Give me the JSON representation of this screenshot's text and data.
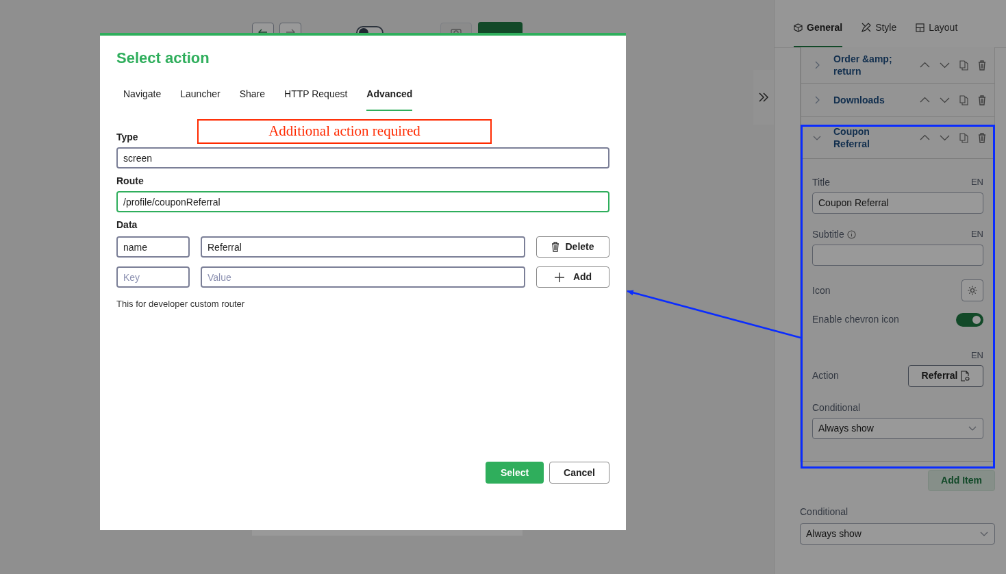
{
  "toolbar": {
    "mode_toggle": {
      "on": false
    }
  },
  "modal": {
    "title": "Select action",
    "tabs": [
      {
        "label": "Navigate",
        "selected": false
      },
      {
        "label": "Launcher",
        "selected": false
      },
      {
        "label": "Share",
        "selected": false
      },
      {
        "label": "HTTP Request",
        "selected": false
      },
      {
        "label": "Advanced",
        "selected": true
      }
    ],
    "annotation": "Additional action required",
    "type": {
      "label": "Type",
      "value": "screen"
    },
    "route": {
      "label": "Route",
      "value": "/profile/couponReferral"
    },
    "data": {
      "label": "Data",
      "rows": [
        {
          "kind": "entry",
          "key": "name",
          "value": "Referral",
          "button": "Delete"
        },
        {
          "kind": "new",
          "key_placeholder": "Key",
          "value_placeholder": "Value",
          "button": "Add"
        }
      ]
    },
    "help": "This for developer custom router",
    "buttons": [
      "Select",
      "Cancel"
    ]
  },
  "panel": {
    "tabs": [
      {
        "label": "General",
        "selected": true
      },
      {
        "label": "Style",
        "selected": false
      },
      {
        "label": "Layout",
        "selected": false
      }
    ],
    "items": [
      {
        "title": "Order &amp; return",
        "expanded": false
      },
      {
        "title": "Downloads",
        "expanded": false
      },
      {
        "title": "Coupon Referral",
        "expanded": true,
        "fields": {
          "title": {
            "label": "Title",
            "lang": "EN",
            "value": "Coupon Referral"
          },
          "subtitle": {
            "label": "Subtitle",
            "lang": "EN"
          },
          "icon": {
            "label": "Icon"
          },
          "chevron": {
            "label": "Enable chevron icon",
            "on": true
          },
          "action": {
            "lang": "EN",
            "label": "Action",
            "button": "Referral"
          },
          "conditional": {
            "label": "Conditional",
            "value": "Always show"
          }
        }
      }
    ],
    "add_item": "Add Item",
    "conditional": {
      "label": "Conditional",
      "value": "Always show"
    }
  }
}
